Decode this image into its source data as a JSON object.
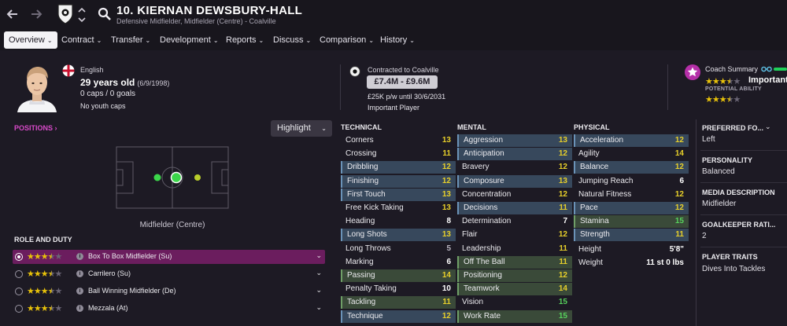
{
  "header": {
    "player_name": "10. KIERNAN DEWSBURY-HALL",
    "player_subtitle": "Defensive Midfielder, Midfielder (Centre) - Coalville"
  },
  "tabs": [
    {
      "label": "Overview"
    },
    {
      "label": "Contract"
    },
    {
      "label": "Transfer"
    },
    {
      "label": "Development"
    },
    {
      "label": "Reports"
    },
    {
      "label": "Discuss"
    },
    {
      "label": "Comparison"
    },
    {
      "label": "History"
    }
  ],
  "profile": {
    "nationality": "English",
    "age": "29 years old",
    "dob": "(6/9/1998)",
    "caps": "0 caps / 0 goals",
    "youth_caps": "No youth caps"
  },
  "contract": {
    "label": "Contracted to Coalville",
    "value": "£7.4M - £9.6M",
    "wage": "£25K p/w until 30/6/2031",
    "status": "Important Player"
  },
  "coach": {
    "label": "Coach Summary",
    "importance": "Important",
    "pa_label": "POTENTIAL ABILITY",
    "ca_stars": 3.5,
    "pa_stars": 3.5
  },
  "positions": {
    "label": "POSITIONS",
    "highlight_label": "Highlight",
    "caption": "Midfielder (Centre)"
  },
  "roles": {
    "title": "ROLE AND DUTY",
    "items": [
      {
        "name": "Box To Box Midfielder (Su)",
        "stars": 3.5,
        "selected": true
      },
      {
        "name": "Carrilero (Su)",
        "stars": 3.5,
        "selected": false
      },
      {
        "name": "Ball Winning Midfielder (De)",
        "stars": 3.5,
        "selected": false
      },
      {
        "name": "Mezzala (At)",
        "stars": 3.5,
        "selected": false
      }
    ]
  },
  "attributes": {
    "technical": {
      "title": "TECHNICAL",
      "items": [
        {
          "name": "Corners",
          "value": "13",
          "hl": ""
        },
        {
          "name": "Crossing",
          "value": "11",
          "hl": ""
        },
        {
          "name": "Dribbling",
          "value": "12",
          "hl": "blue"
        },
        {
          "name": "Finishing",
          "value": "12",
          "hl": "blue"
        },
        {
          "name": "First Touch",
          "value": "13",
          "hl": "blue"
        },
        {
          "name": "Free Kick Taking",
          "value": "13",
          "hl": ""
        },
        {
          "name": "Heading",
          "value": "8",
          "hl": ""
        },
        {
          "name": "Long Shots",
          "value": "13",
          "hl": "blue"
        },
        {
          "name": "Long Throws",
          "value": "5",
          "hl": ""
        },
        {
          "name": "Marking",
          "value": "6",
          "hl": ""
        },
        {
          "name": "Passing",
          "value": "14",
          "hl": "green"
        },
        {
          "name": "Penalty Taking",
          "value": "10",
          "hl": ""
        },
        {
          "name": "Tackling",
          "value": "11",
          "hl": "green"
        },
        {
          "name": "Technique",
          "value": "12",
          "hl": "blue"
        }
      ]
    },
    "mental": {
      "title": "MENTAL",
      "items": [
        {
          "name": "Aggression",
          "value": "13",
          "hl": "blue"
        },
        {
          "name": "Anticipation",
          "value": "12",
          "hl": "blue"
        },
        {
          "name": "Bravery",
          "value": "12",
          "hl": ""
        },
        {
          "name": "Composure",
          "value": "13",
          "hl": "blue"
        },
        {
          "name": "Concentration",
          "value": "12",
          "hl": ""
        },
        {
          "name": "Decisions",
          "value": "11",
          "hl": "blue"
        },
        {
          "name": "Determination",
          "value": "7",
          "hl": ""
        },
        {
          "name": "Flair",
          "value": "12",
          "hl": ""
        },
        {
          "name": "Leadership",
          "value": "11",
          "hl": ""
        },
        {
          "name": "Off The Ball",
          "value": "11",
          "hl": "green"
        },
        {
          "name": "Positioning",
          "value": "12",
          "hl": "green"
        },
        {
          "name": "Teamwork",
          "value": "14",
          "hl": "green"
        },
        {
          "name": "Vision",
          "value": "15",
          "hl": ""
        },
        {
          "name": "Work Rate",
          "value": "15",
          "hl": "green"
        }
      ]
    },
    "physical": {
      "title": "PHYSICAL",
      "items": [
        {
          "name": "Acceleration",
          "value": "12",
          "hl": "blue"
        },
        {
          "name": "Agility",
          "value": "14",
          "hl": ""
        },
        {
          "name": "Balance",
          "value": "12",
          "hl": "blue"
        },
        {
          "name": "Jumping Reach",
          "value": "6",
          "hl": ""
        },
        {
          "name": "Natural Fitness",
          "value": "12",
          "hl": ""
        },
        {
          "name": "Pace",
          "value": "12",
          "hl": "blue"
        },
        {
          "name": "Stamina",
          "value": "15",
          "hl": "green"
        },
        {
          "name": "Strength",
          "value": "11",
          "hl": "blue"
        }
      ],
      "height_label": "Height",
      "height_value": "5'8\"",
      "weight_label": "Weight",
      "weight_value": "11 st 0 lbs"
    }
  },
  "side": {
    "preferred_foot_title": "PREFERRED FO...",
    "preferred_foot": "Left",
    "personality_title": "PERSONALITY",
    "personality": "Balanced",
    "media_title": "MEDIA DESCRIPTION",
    "media": "Midfielder",
    "gk_title": "GOALKEEPER RATI...",
    "gk_rating": "2",
    "traits_title": "PLAYER TRAITS",
    "traits": "Dives Into Tackles"
  }
}
